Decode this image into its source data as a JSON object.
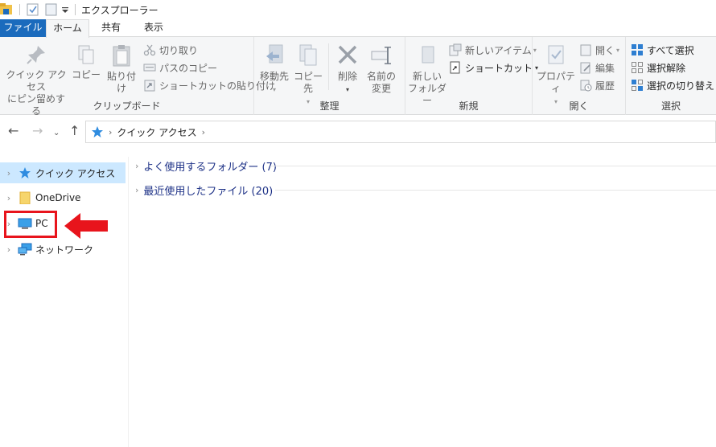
{
  "window": {
    "title": "エクスプローラー"
  },
  "tabs": {
    "file": "ファイル",
    "home": "ホーム",
    "share": "共有",
    "view": "表示"
  },
  "ribbon": {
    "clipboard": {
      "label": "クリップボード",
      "pin_line1": "クイック アクセス",
      "pin_line2": "にピン留めする",
      "copy": "コピー",
      "paste": "貼り付け",
      "cut": "切り取り",
      "copy_path": "パスのコピー",
      "paste_shortcut": "ショートカットの貼り付け"
    },
    "organize": {
      "label": "整理",
      "move_to": "移動先",
      "copy_to": "コピー先",
      "delete": "削除",
      "rename_line1": "名前の",
      "rename_line2": "変更"
    },
    "new": {
      "label": "新規",
      "new_folder_line1": "新しい",
      "new_folder_line2": "フォルダー",
      "new_item": "新しいアイテム",
      "shortcut": "ショートカット"
    },
    "open": {
      "label": "開く",
      "properties": "プロパティ",
      "open": "開く",
      "edit": "編集",
      "history": "履歴"
    },
    "select": {
      "label": "選択",
      "select_all": "すべて選択",
      "select_none": "選択解除",
      "invert": "選択の切り替え"
    }
  },
  "address": {
    "location": "クイック アクセス"
  },
  "nav_pane": [
    {
      "label": "クイック アクセス"
    },
    {
      "label": "OneDrive"
    },
    {
      "label": "PC"
    },
    {
      "label": "ネットワーク"
    }
  ],
  "content": {
    "sections": [
      {
        "label": "よく使用するフォルダー (7)"
      },
      {
        "label": "最近使用したファイル (20)"
      }
    ]
  },
  "colors": {
    "accent": "#1b6bbd",
    "selection": "#cce8ff",
    "annotation": "#e8141c",
    "section_text": "#1e3287"
  }
}
